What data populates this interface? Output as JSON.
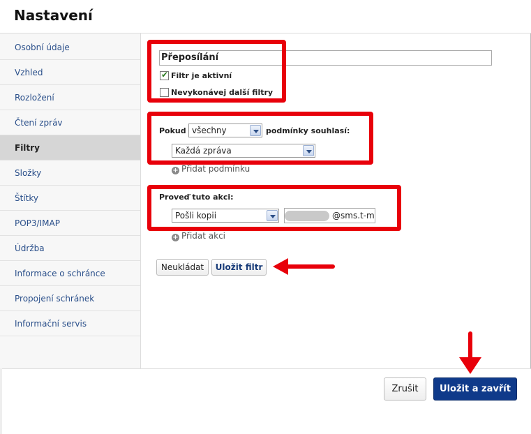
{
  "window": {
    "title": "Nastavení"
  },
  "sidebar": {
    "items": [
      {
        "label": "Osobní údaje",
        "active": false
      },
      {
        "label": "Vzhled",
        "active": false
      },
      {
        "label": "Rozložení",
        "active": false
      },
      {
        "label": "Čtení zpráv",
        "active": false
      },
      {
        "label": "Filtry",
        "active": true
      },
      {
        "label": "Složky",
        "active": false
      },
      {
        "label": "Štítky",
        "active": false
      },
      {
        "label": "POP3/IMAP",
        "active": false
      },
      {
        "label": "Údržba",
        "active": false
      },
      {
        "label": "Informace o schránce",
        "active": false
      },
      {
        "label": "Propojení schránek",
        "active": false
      },
      {
        "label": "Informační servis",
        "active": false
      }
    ]
  },
  "filter": {
    "name_value": "Přeposílání",
    "active_checkbox": {
      "label": "Filtr je aktivní",
      "checked": true
    },
    "stop_checkbox": {
      "label": "Nevykonávej další filtry",
      "checked": false
    }
  },
  "conditions": {
    "prefix": "Pokud",
    "match_select": "všechny",
    "suffix": "podmínky souhlasí:",
    "condition_select": "Každá zpráva",
    "add_condition": "Přidat podmínku"
  },
  "actions": {
    "heading": "Proveď tuto akci:",
    "action_select": "Pošli kopii",
    "recipient_value": "@sms.t-m",
    "add_action": "Přidat akci"
  },
  "buttons": {
    "dont_save": "Neukládat",
    "save_filter": "Uložit filtr",
    "cancel": "Zrušit",
    "save_close": "Uložit a zavřít"
  },
  "colors": {
    "annotation_red": "#e8000a",
    "primary_button": "#0f3a8a",
    "link_blue": "#2a4f8a"
  }
}
